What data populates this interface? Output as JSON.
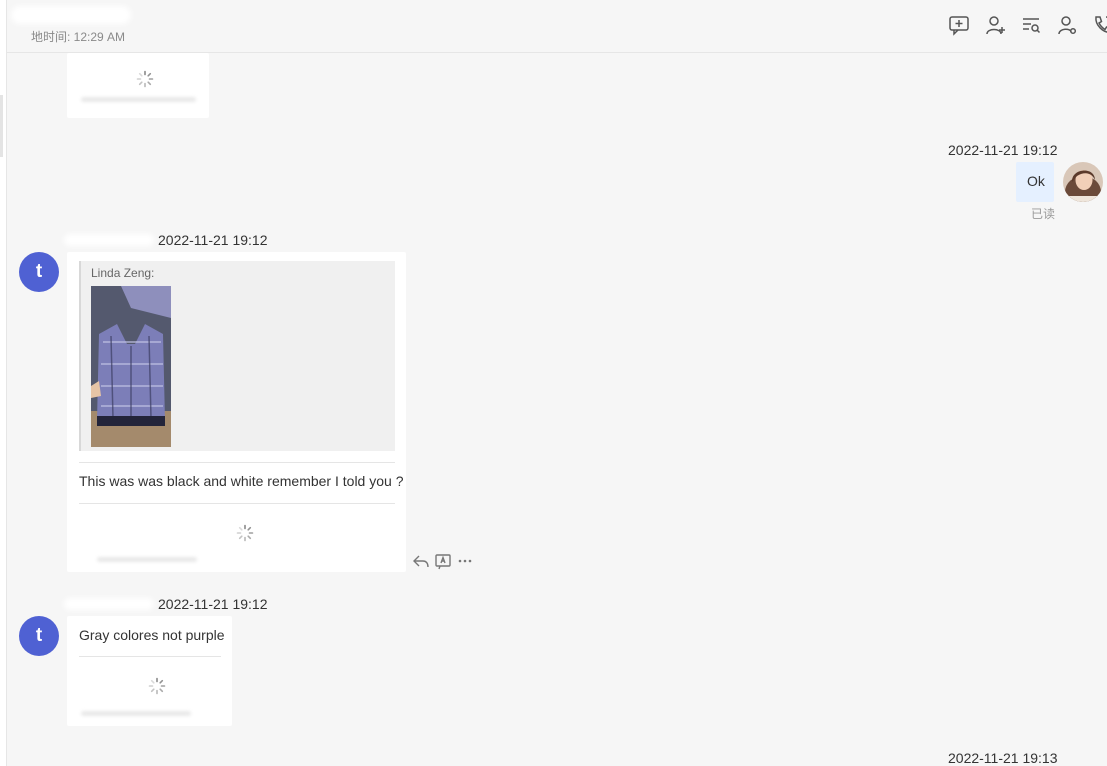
{
  "header": {
    "local_time": "地时间: 12:29 AM",
    "tools": [
      {
        "name": "new-message-icon"
      },
      {
        "name": "add-contact-icon"
      },
      {
        "name": "search-history-icon"
      },
      {
        "name": "contact-settings-icon"
      },
      {
        "name": "call-icon"
      }
    ]
  },
  "messages": {
    "out1": {
      "timestamp": "2022-11-21 19:12",
      "text": "Ok",
      "status": "已读"
    },
    "in1": {
      "timestamp": "2022-11-21 19:12",
      "quote_author": "Linda Zeng:",
      "text": "This was was black and white remember I told you ?"
    },
    "in2": {
      "timestamp": "2022-11-21 19:12",
      "text": "Gray colores not purple"
    },
    "out2": {
      "timestamp": "2022-11-21 19:13"
    }
  },
  "avatar_letter": "t",
  "colors": {
    "avatar": "#4f61d3",
    "outgoing_bubble": "#e5f0ff",
    "background": "#f6f6f6"
  },
  "message_actions": [
    "reply-icon",
    "translate-icon",
    "more-icon"
  ]
}
